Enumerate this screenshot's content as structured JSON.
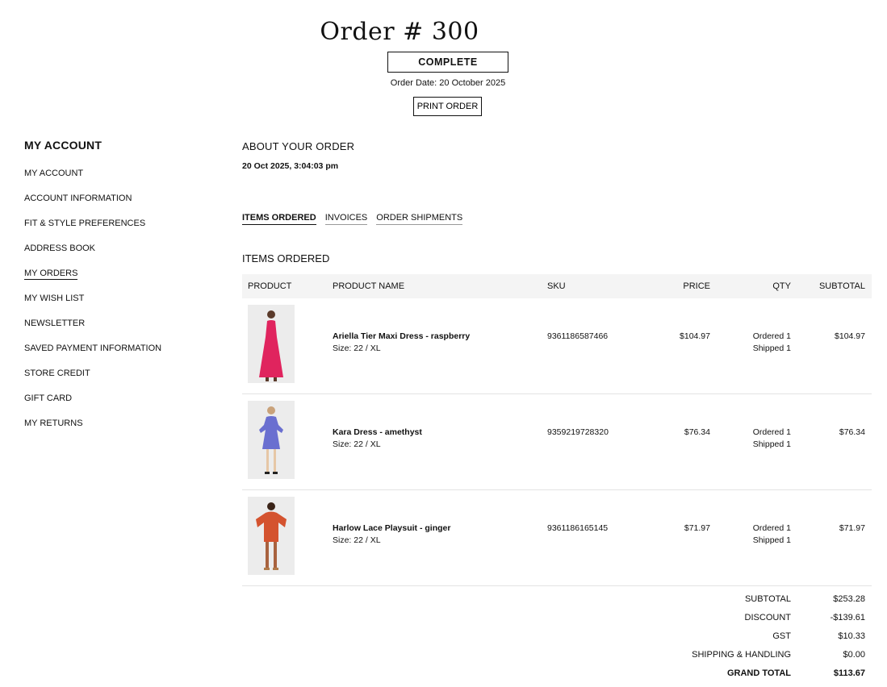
{
  "header": {
    "order_title": "Order # 300",
    "status": "COMPLETE",
    "order_date": "Order Date: 20 October 2025",
    "print_label": "PRINT ORDER"
  },
  "sidebar": {
    "title": "MY ACCOUNT",
    "items": [
      {
        "label": "MY ACCOUNT",
        "active": false
      },
      {
        "label": "ACCOUNT INFORMATION",
        "active": false
      },
      {
        "label": "FIT & STYLE PREFERENCES",
        "active": false
      },
      {
        "label": "ADDRESS BOOK",
        "active": false
      },
      {
        "label": "MY ORDERS",
        "active": true
      },
      {
        "label": "MY WISH LIST",
        "active": false
      },
      {
        "label": "NEWSLETTER",
        "active": false
      },
      {
        "label": "SAVED PAYMENT INFORMATION",
        "active": false
      },
      {
        "label": "STORE CREDIT",
        "active": false
      },
      {
        "label": "GIFT CARD",
        "active": false
      },
      {
        "label": "MY RETURNS",
        "active": false
      }
    ]
  },
  "about": {
    "title": "ABOUT YOUR ORDER",
    "datetime": "20 Oct 2025, 3:04:03 pm"
  },
  "tabs": [
    {
      "label": "ITEMS ORDERED",
      "active": true
    },
    {
      "label": "INVOICES",
      "active": false
    },
    {
      "label": "ORDER SHIPMENTS",
      "active": false
    }
  ],
  "items_heading": "ITEMS ORDERED",
  "table": {
    "columns": [
      "PRODUCT",
      "PRODUCT NAME",
      "SKU",
      "PRICE",
      "QTY",
      "SUBTOTAL"
    ],
    "rows": [
      {
        "name": "Ariella Tier Maxi Dress - raspberry",
        "size": "Size: 22 / XL",
        "sku": "9361186587466",
        "price": "$104.97",
        "ordered": "Ordered 1",
        "shipped": "Shipped 1",
        "subtotal": "$104.97",
        "image_color": "#e0245e"
      },
      {
        "name": "Kara Dress - amethyst",
        "size": "Size: 22 / XL",
        "sku": "9359219728320",
        "price": "$76.34",
        "ordered": "Ordered 1",
        "shipped": "Shipped 1",
        "subtotal": "$76.34",
        "image_color": "#6a6fd0"
      },
      {
        "name": "Harlow Lace Playsuit - ginger",
        "size": "Size: 22 / XL",
        "sku": "9361186165145",
        "price": "$71.97",
        "ordered": "Ordered 1",
        "shipped": "Shipped 1",
        "subtotal": "$71.97",
        "image_color": "#d4532f"
      }
    ]
  },
  "totals": [
    {
      "label": "SUBTOTAL",
      "value": "$253.28"
    },
    {
      "label": "DISCOUNT",
      "value": "-$139.61"
    },
    {
      "label": "GST",
      "value": "$10.33"
    },
    {
      "label": "SHIPPING & HANDLING",
      "value": "$0.00"
    },
    {
      "label": "GRAND TOTAL",
      "value": "$113.67"
    }
  ]
}
